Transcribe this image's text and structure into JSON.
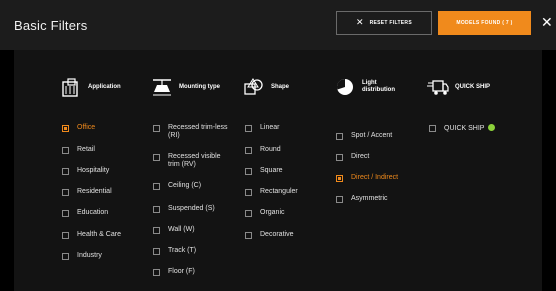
{
  "header": {
    "title": "Basic Filters",
    "reset_label": "RESET FILTERS",
    "reset_icon": "✕",
    "models_label": "MODELS FOUND ( 7 )",
    "close_icon": "✕"
  },
  "columns": [
    {
      "heading": "Application",
      "icon": "building-icon",
      "options": [
        {
          "label": "Office",
          "checked": true
        },
        {
          "label": "Retail",
          "checked": false
        },
        {
          "label": "Hospitality",
          "checked": false
        },
        {
          "label": "Residential",
          "checked": false
        },
        {
          "label": "Education",
          "checked": false
        },
        {
          "label": "Health & Care",
          "checked": false
        },
        {
          "label": "Industry",
          "checked": false
        }
      ]
    },
    {
      "heading": "Mounting type",
      "icon": "ceiling-lamp-icon",
      "options": [
        {
          "label": "Recessed trim-less (RI)",
          "checked": false
        },
        {
          "label": "Recessed visible trim (RV)",
          "checked": false
        },
        {
          "label": "Ceiling (C)",
          "checked": false
        },
        {
          "label": "Suspended (S)",
          "checked": false
        },
        {
          "label": "Wall (W)",
          "checked": false
        },
        {
          "label": "Track (T)",
          "checked": false
        },
        {
          "label": "Floor (F)",
          "checked": false
        }
      ]
    },
    {
      "heading": "Shape",
      "icon": "shapes-icon",
      "options": [
        {
          "label": "Linear",
          "checked": false
        },
        {
          "label": "Round",
          "checked": false
        },
        {
          "label": "Square",
          "checked": false
        },
        {
          "label": "Rectanguler",
          "checked": false
        },
        {
          "label": "Organic",
          "checked": false
        },
        {
          "label": "Decorative",
          "checked": false
        }
      ]
    },
    {
      "heading": "Light distribution",
      "icon": "light-distribution-icon",
      "options": [
        {
          "label": "Spot / Accent",
          "checked": false
        },
        {
          "label": "Direct",
          "checked": false
        },
        {
          "label": "Direct / Indirect",
          "checked": true
        },
        {
          "label": "Asymmetric",
          "checked": false
        }
      ]
    },
    {
      "heading": "QUICK SHIP",
      "icon": "truck-icon",
      "options": [
        {
          "label": "QUICK SHIP",
          "checked": false,
          "badge_color": "#8cd13a"
        }
      ]
    }
  ],
  "colors": {
    "accent": "#f08a1c",
    "header_bg": "#1c1c1c",
    "panel_bg": "#131313",
    "quickship_dot": "#8cd13a"
  }
}
